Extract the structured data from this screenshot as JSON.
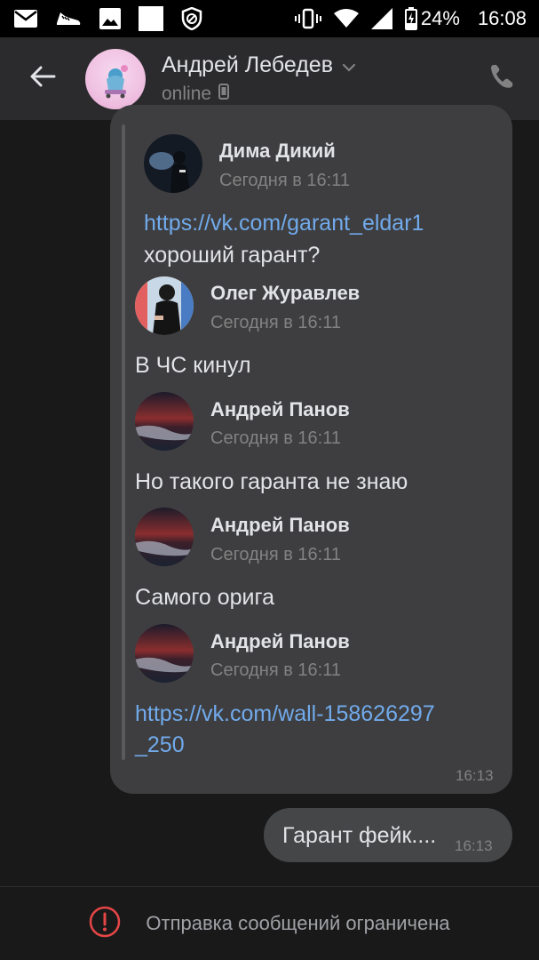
{
  "status_bar": {
    "battery": "24%",
    "time": "16:08"
  },
  "header": {
    "name": "Андрей Лебедев",
    "status": "online"
  },
  "forwarded": [
    {
      "author": "Дима Дикий",
      "time": "Сегодня в 16:11",
      "link": "https://vk.com/garant_eldar1",
      "text": "хороший гарант?"
    },
    {
      "author": "Олег Журавлев",
      "time": "Сегодня в 16:11",
      "text": "В ЧС кинул"
    },
    {
      "author": "Андрей Панов",
      "time": "Сегодня в 16:11",
      "text": "Но такого гаранта не знаю"
    },
    {
      "author": "Андрей Панов",
      "time": "Сегодня в 16:11",
      "text": "Самого орига"
    },
    {
      "author": "Андрей Панов",
      "time": "Сегодня в 16:11",
      "link_line1": "https://vk.com/wall-158626297",
      "link_line2": "_250"
    }
  ],
  "incoming_time": "16:13",
  "outgoing": {
    "text": "Гарант фейк....",
    "time": "16:13"
  },
  "footer": {
    "text": "Отправка сообщений ограничена"
  },
  "colors": {
    "link": "#71aaeb",
    "alert": "#e64646",
    "bubble_in": "#3e3e40",
    "bubble_out": "#454647"
  }
}
